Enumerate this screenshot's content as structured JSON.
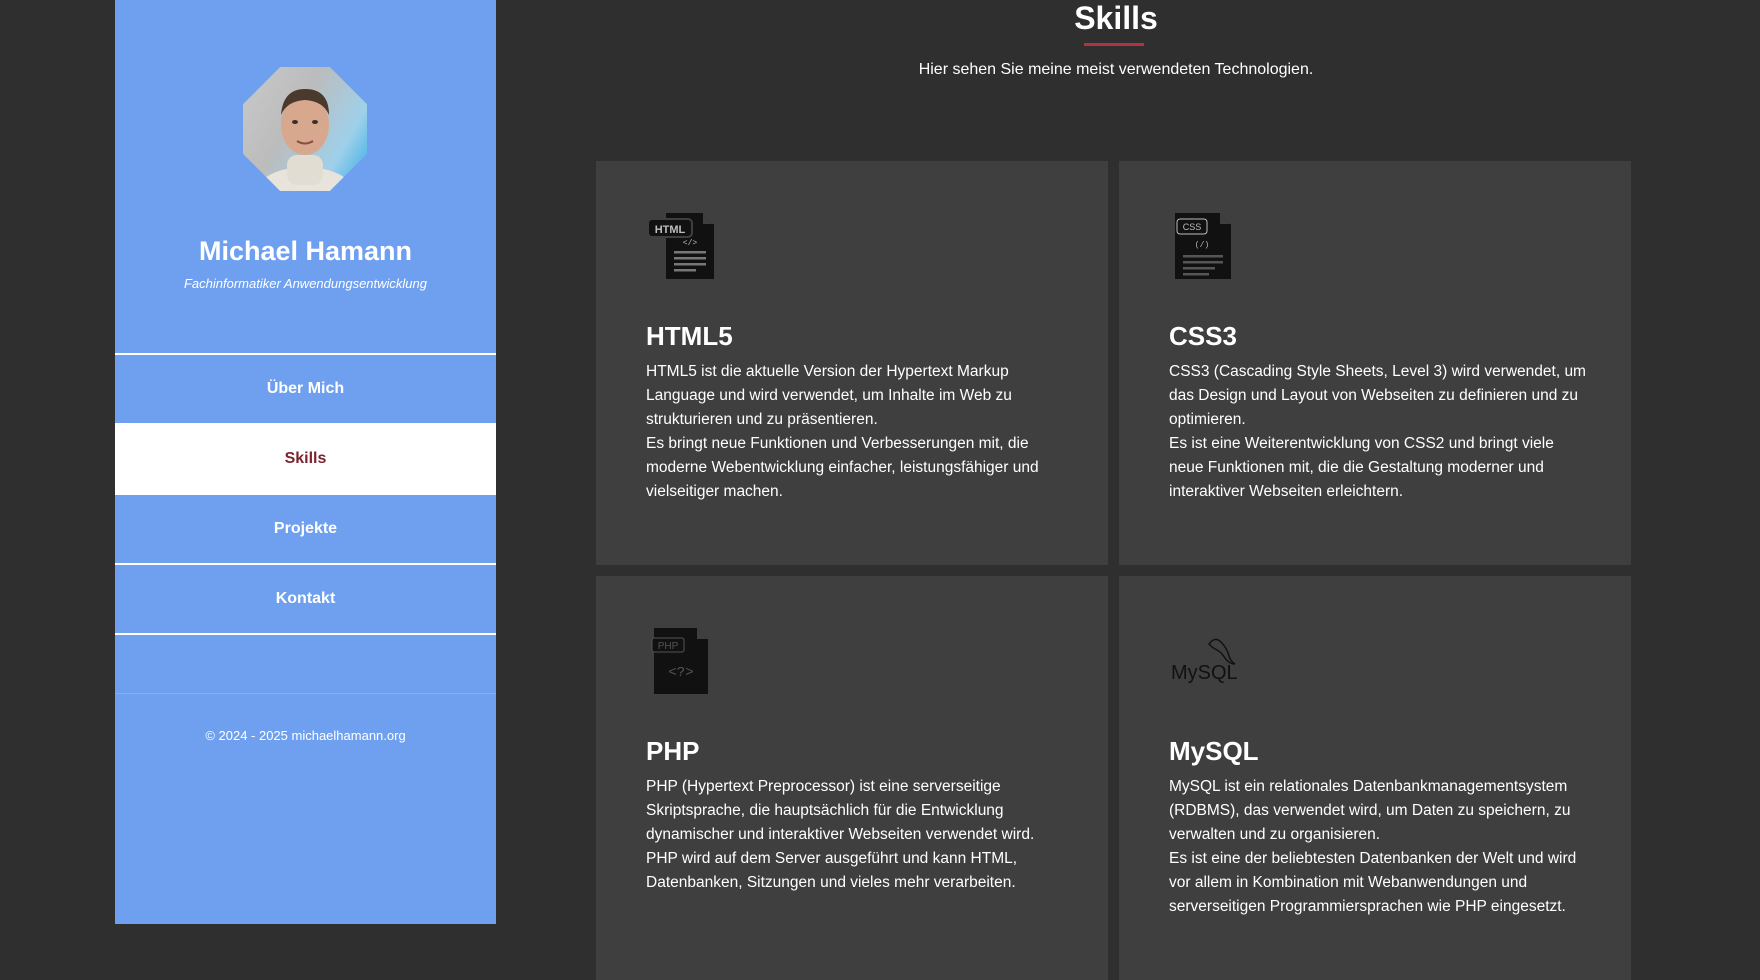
{
  "profile": {
    "name": "Michael Hamann",
    "role": "Fachinformatiker Anwendungsentwicklung"
  },
  "nav": {
    "items": [
      {
        "label": "Über Mich"
      },
      {
        "label": "Skills"
      },
      {
        "label": "Projekte"
      },
      {
        "label": "Kontakt"
      }
    ],
    "active": "Skills"
  },
  "footer": {
    "copyright": "© 2024 - 2025 michaelhamann.org"
  },
  "page": {
    "title": "Skills",
    "subtitle": "Hier sehen Sie meine meist verwendeten Technologien."
  },
  "colors": {
    "sidebar": "#6fa0f0",
    "background": "#2f2f2f",
    "card": "#3f3f3f",
    "accent": "#b2323d",
    "active_nav_text": "#7a2430"
  },
  "skills": [
    {
      "title": "HTML5",
      "icon": "html-file-icon",
      "icon_text": "HTML",
      "paragraphs": [
        "HTML5 ist die aktuelle Version der Hypertext Markup Language und wird verwendet, um Inhalte im Web zu strukturieren und zu präsentieren.",
        "Es bringt neue Funktionen und Verbesserungen mit, die moderne Webentwicklung einfacher, leistungsfähiger und vielseitiger machen."
      ]
    },
    {
      "title": "CSS3",
      "icon": "css-file-icon",
      "icon_text": "CSS",
      "paragraphs": [
        "CSS3 (Cascading Style Sheets, Level 3) wird verwendet, um das Design und Layout von Webseiten zu definieren und zu optimieren.",
        "Es ist eine Weiterentwicklung von CSS2 und bringt viele neue Funktionen mit, die die Gestaltung moderner und interaktiver Webseiten erleichtern."
      ]
    },
    {
      "title": "PHP",
      "icon": "php-file-icon",
      "icon_text": "PHP",
      "paragraphs": [
        "PHP (Hypertext Preprocessor) ist eine serverseitige Skriptsprache, die hauptsächlich für die Entwicklung dynamischer und interaktiver Webseiten verwendet wird.",
        "PHP wird auf dem Server ausgeführt und kann HTML, Datenbanken, Sitzungen und vieles mehr verarbeiten."
      ]
    },
    {
      "title": "MySQL",
      "icon": "mysql-logo-icon",
      "icon_text": "MySQL",
      "paragraphs": [
        "MySQL ist ein relationales Datenbankmanagementsystem (RDBMS), das verwendet wird, um Daten zu speichern, zu verwalten und zu organisieren.",
        "Es ist eine der beliebtesten Datenbanken der Welt und wird vor allem in Kombination mit Webanwendungen und serverseitigen Programmiersprachen wie PHP eingesetzt."
      ]
    }
  ]
}
